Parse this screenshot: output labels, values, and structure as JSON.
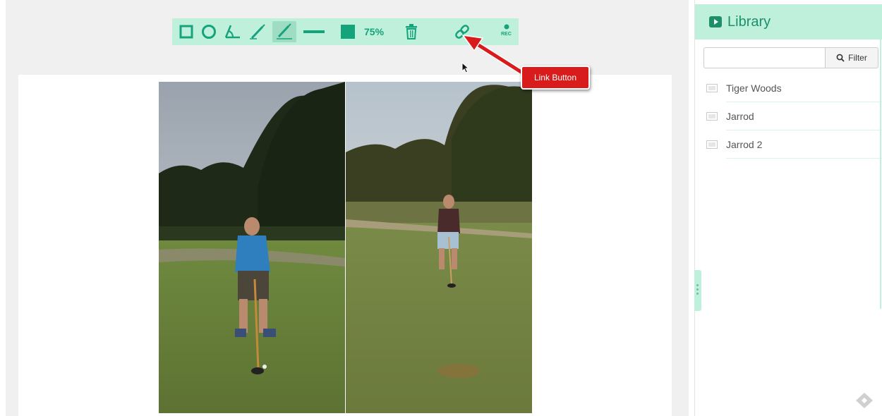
{
  "toolbar": {
    "tools": [
      "rectangle-icon",
      "circle-icon",
      "angle-icon",
      "line-pencil-icon",
      "pencil-icon",
      "horizontal-line-icon",
      "fill-color-square-icon"
    ],
    "zoom": "75%",
    "delete_icon": "trash-icon",
    "link_icon": "link-icon",
    "rec_label": "REC",
    "accent_color": "#14a37a",
    "bar_color": "#bff0dc"
  },
  "annotation": {
    "callout_text": "Link Button",
    "callout_color": "#d81c1c"
  },
  "library": {
    "title": "Library",
    "search": {
      "value": "",
      "placeholder": ""
    },
    "filter_label": "Filter",
    "items": [
      {
        "label": "Tiger Woods"
      },
      {
        "label": "Jarrod"
      },
      {
        "label": "Jarrod 2"
      }
    ]
  }
}
